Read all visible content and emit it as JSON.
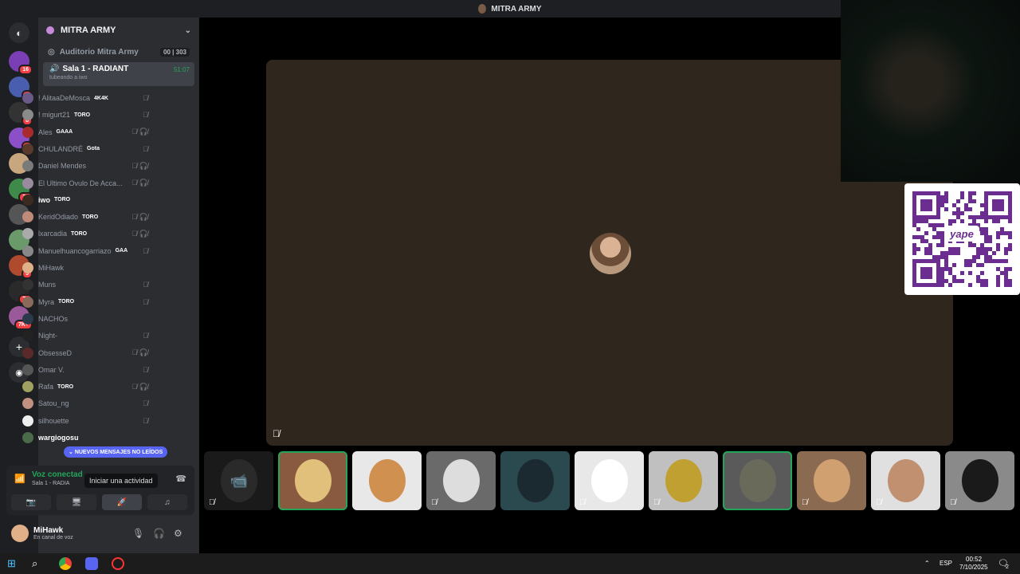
{
  "window": {
    "title": "MITRA ARMY"
  },
  "servers": [
    {
      "name": "server-1",
      "badge": "16",
      "color": "#7b3fb5"
    },
    {
      "name": "server-2",
      "badge": "4",
      "color": "#4a5eb0"
    },
    {
      "name": "server-3",
      "badge": "8",
      "color": "#333"
    },
    {
      "name": "server-4",
      "badge": "6",
      "color": "#8b4fc8"
    },
    {
      "name": "server-5",
      "badge": "",
      "color": "#c9a77e"
    },
    {
      "name": "server-6",
      "badge": "39",
      "color": "#3f8a4b"
    },
    {
      "name": "server-7",
      "badge": "",
      "color": "#555"
    },
    {
      "name": "server-8",
      "badge": "",
      "color": "#6a9a6a"
    },
    {
      "name": "server-9",
      "badge": "3",
      "color": "#b04a2f"
    },
    {
      "name": "server-10",
      "badge": "74",
      "color": "#2a2a2a"
    },
    {
      "name": "server-11",
      "badge": "7K+",
      "color": "#9a5a9a"
    }
  ],
  "guild": {
    "name": "MITRA ARMY"
  },
  "stage_channel": {
    "name": "Auditorio Mitra Army",
    "count_a": "00",
    "count_b": "303"
  },
  "voice_channel": {
    "name": "Sala 1 - RADIANT",
    "subtitle": "tubeando a iwo",
    "time": "51:07"
  },
  "members": [
    {
      "name": "! AlitaaDeMosca",
      "tag": "4K4K",
      "color": "#6a5a8a",
      "icons": "🎙̸"
    },
    {
      "name": "! migurt21",
      "tag": "TORO",
      "color": "#8a8a8a",
      "icons": "🎙̸"
    },
    {
      "name": "Ales",
      "tag": "GAAA",
      "color": "#a82a2a",
      "icons": "🎙̸ 🎧̸"
    },
    {
      "name": "CHULANDRÉ",
      "tag": "Gota",
      "color": "#5a3a2a",
      "icons": "🎙̸"
    },
    {
      "name": "Daniel Mendes",
      "tag": "",
      "color": "#7a7a7a",
      "icons": "🎙̸ 🎧̸"
    },
    {
      "name": "El Ultimo Ovulo De Acca...",
      "tag": "",
      "color": "#9a8aa0",
      "icons": "🎙̸ 🎧̸"
    },
    {
      "name": "iwo",
      "tag": "TORO",
      "color": "#3a2a20",
      "icons": "",
      "bright": true
    },
    {
      "name": "KeridOdiado",
      "tag": "TORO",
      "color": "#c08a7a",
      "icons": "🎙̸ 🎧̸"
    },
    {
      "name": "lxarcadia",
      "tag": "TORO",
      "color": "#aaa",
      "icons": "🎙̸ 🎧̸"
    },
    {
      "name": "Manuelhuancogarriazo",
      "tag": "GAA",
      "color": "#888",
      "icons": "🎙̸"
    },
    {
      "name": "MiHawk",
      "tag": "",
      "color": "#e0b088",
      "icons": ""
    },
    {
      "name": "Muns",
      "tag": "",
      "color": "#333",
      "icons": "🎙̸"
    },
    {
      "name": "Myra",
      "tag": "TORO",
      "color": "#8a6a5a",
      "icons": "🎙̸"
    },
    {
      "name": "NACHOs",
      "tag": "",
      "color": "#2a3a4a",
      "icons": ""
    },
    {
      "name": "Night-",
      "tag": "",
      "color": "#222",
      "icons": "🎙̸"
    },
    {
      "name": "ObsesseD",
      "tag": "",
      "color": "#5a2a2a",
      "icons": "🎙̸ 🎧̸"
    },
    {
      "name": "Omar V.",
      "tag": "",
      "color": "#555",
      "icons": "🎙̸"
    },
    {
      "name": "Rafa",
      "tag": "TORO",
      "color": "#a0a060",
      "icons": "🎙̸ 🎧̸"
    },
    {
      "name": "Satou_ng",
      "tag": "",
      "color": "#c09080",
      "icons": "🎙̸"
    },
    {
      "name": "silhouette",
      "tag": "",
      "color": "#eee",
      "icons": "🎙̸"
    },
    {
      "name": "wargiogosu",
      "tag": "",
      "color": "#4a6a4a",
      "icons": "",
      "bright": true
    }
  ],
  "unread_pill": "NUEVOS MENSAJES NO LEÍDOS",
  "connection": {
    "status": "Voz conectad",
    "channel": "Sala 1 - RADIA"
  },
  "tooltip": "Iniciar una actividad",
  "user": {
    "name": "MiHawk",
    "status": "En canal de voz"
  },
  "tiles": [
    {
      "name": "tile-camera",
      "bg": "#1a1a1a",
      "av": "#2a2a2a",
      "muted": true,
      "speaking": false
    },
    {
      "name": "tile-2",
      "bg": "#8a5a40",
      "av": "#e0c07a",
      "muted": false,
      "speaking": true
    },
    {
      "name": "tile-3",
      "bg": "#e8e8e8",
      "av": "#d09050",
      "muted": false,
      "speaking": false
    },
    {
      "name": "tile-4",
      "bg": "#6a6a6a",
      "av": "#ddd",
      "muted": true,
      "speaking": false
    },
    {
      "name": "tile-5",
      "bg": "#2a4a50",
      "av": "#1a2a30",
      "muted": false,
      "speaking": false
    },
    {
      "name": "tile-6",
      "bg": "#e8e8e8",
      "av": "#fff",
      "muted": true,
      "speaking": false
    },
    {
      "name": "tile-7",
      "bg": "#c0c0c0",
      "av": "#c0a030",
      "muted": true,
      "speaking": false
    },
    {
      "name": "tile-8",
      "bg": "#5a5a5a",
      "av": "#6a6a5a",
      "muted": false,
      "speaking": true
    },
    {
      "name": "tile-9",
      "bg": "#8a6a50",
      "av": "#d0a070",
      "muted": true,
      "speaking": false
    },
    {
      "name": "tile-10",
      "bg": "#e0e0e0",
      "av": "#c09070",
      "muted": true,
      "speaking": false
    },
    {
      "name": "tile-11",
      "bg": "#8a8a8a",
      "av": "#1a1a1a",
      "muted": true,
      "speaking": false
    }
  ],
  "qr": {
    "brand": "yape"
  },
  "taskbar": {
    "lang": "ESP",
    "time": "00:52",
    "date": "7/10/2025",
    "notif_count": "2"
  }
}
